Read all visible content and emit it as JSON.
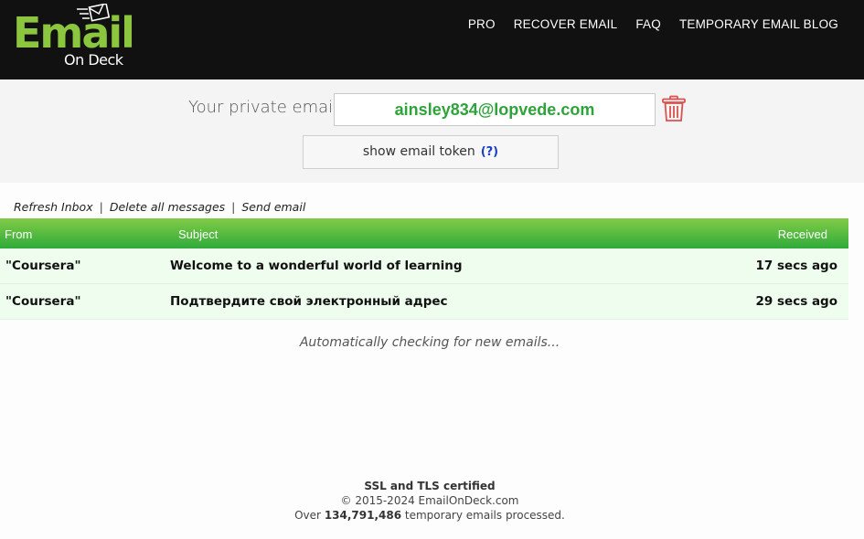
{
  "header": {
    "logo_main": "Email",
    "logo_sub": "On Deck",
    "nav": [
      "PRO",
      "RECOVER EMAIL",
      "FAQ",
      "TEMPORARY EMAIL BLOG"
    ]
  },
  "email_bar": {
    "label": "Your private email",
    "address": "ainsley834@lopvede.com",
    "token_label": "show email token",
    "token_help": "(?)"
  },
  "actions": {
    "refresh": "Refresh Inbox",
    "delete_all": "Delete all messages",
    "send": "Send email",
    "separator": "|"
  },
  "inbox": {
    "headers": {
      "from": "From",
      "subject": "Subject",
      "received": "Received"
    },
    "rows": [
      {
        "from": "\"Coursera\"",
        "subject": "Welcome to a wonderful world of learning",
        "received": "17 secs ago"
      },
      {
        "from": "\"Coursera\"",
        "subject": "Подтвердите свой электронный адрес",
        "received": "29 secs ago"
      }
    ],
    "status": "Automatically checking for new emails..."
  },
  "footer": {
    "ssl": "SSL and TLS certified",
    "copyright": "© 2015-2024 EmailOnDeck.com",
    "processed_prefix": "Over",
    "processed_count": "134,791,486",
    "processed_suffix": "temporary emails processed."
  },
  "colors": {
    "header_bg": "#111111",
    "logo_green": "#8cc63f",
    "email_green": "#2ea33a",
    "table_header_top": "#82cc47",
    "table_header_bottom": "#2eab3a",
    "row_bg": "#eefdee",
    "trash_red": "#d9534f"
  }
}
